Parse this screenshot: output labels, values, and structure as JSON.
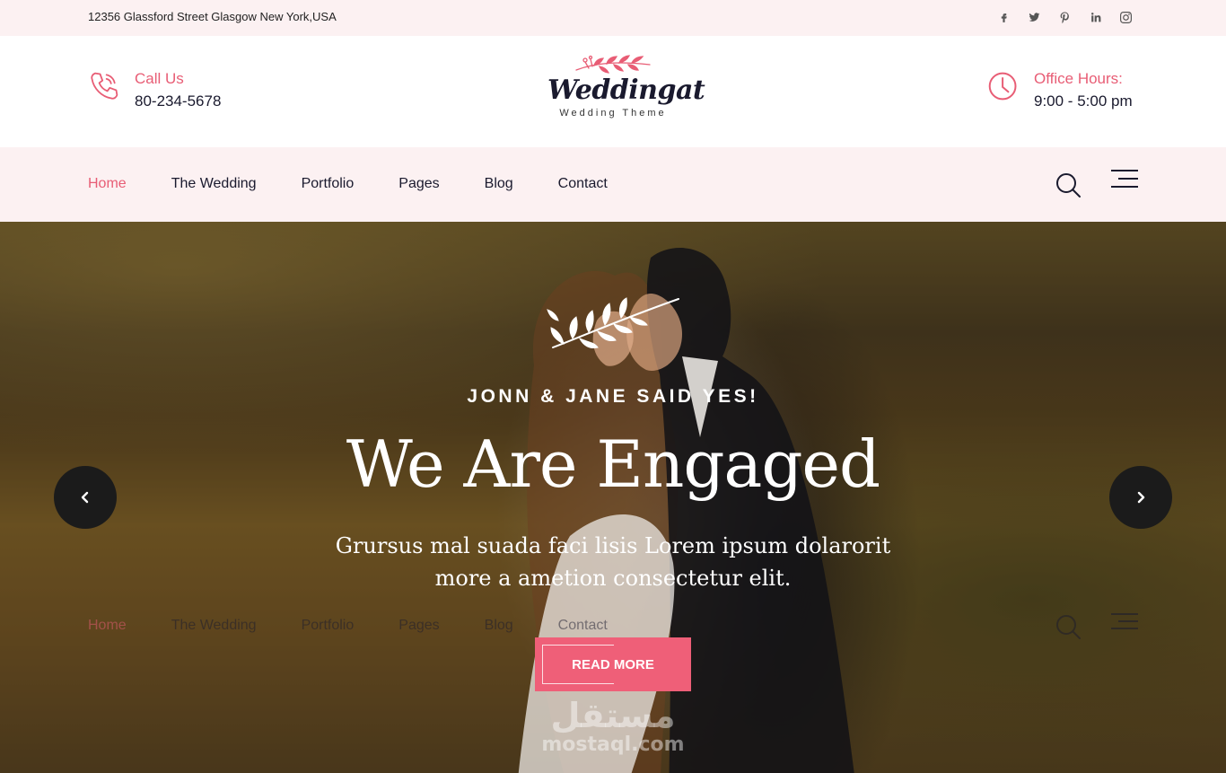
{
  "topbar": {
    "address": "12356 Glassford Street Glasgow New York,USA",
    "socials": [
      "facebook-icon",
      "twitter-icon",
      "pinterest-icon",
      "linkedin-icon",
      "instagram-icon"
    ]
  },
  "header": {
    "call": {
      "label": "Call Us",
      "value": "80-234-5678",
      "icon": "phone-icon"
    },
    "logo": {
      "name": "Weddingat",
      "tagline": "Wedding Theme"
    },
    "hours": {
      "label": "Office Hours:",
      "value": "9:00 - 5:00 pm",
      "icon": "clock-icon"
    }
  },
  "nav": {
    "items": [
      "Home",
      "The Wedding",
      "Portfolio",
      "Pages",
      "Blog",
      "Contact"
    ],
    "active": "Home"
  },
  "hero": {
    "kicker": "JONN & JANE SAID YES!",
    "title": "We Are Engaged",
    "description_line1": "Grursus mal suada faci lisis Lorem ipsum dolarorit",
    "description_line2": "more a ametion consectetur elit.",
    "button": "READ MORE",
    "watermark_arabic": "مستقل",
    "watermark_latin": "mostaql.com"
  },
  "colors": {
    "accent": "#e85d75",
    "button": "#ef5f78",
    "pale_bg": "#fcf1f2",
    "text_dark": "#1a1a2e"
  }
}
